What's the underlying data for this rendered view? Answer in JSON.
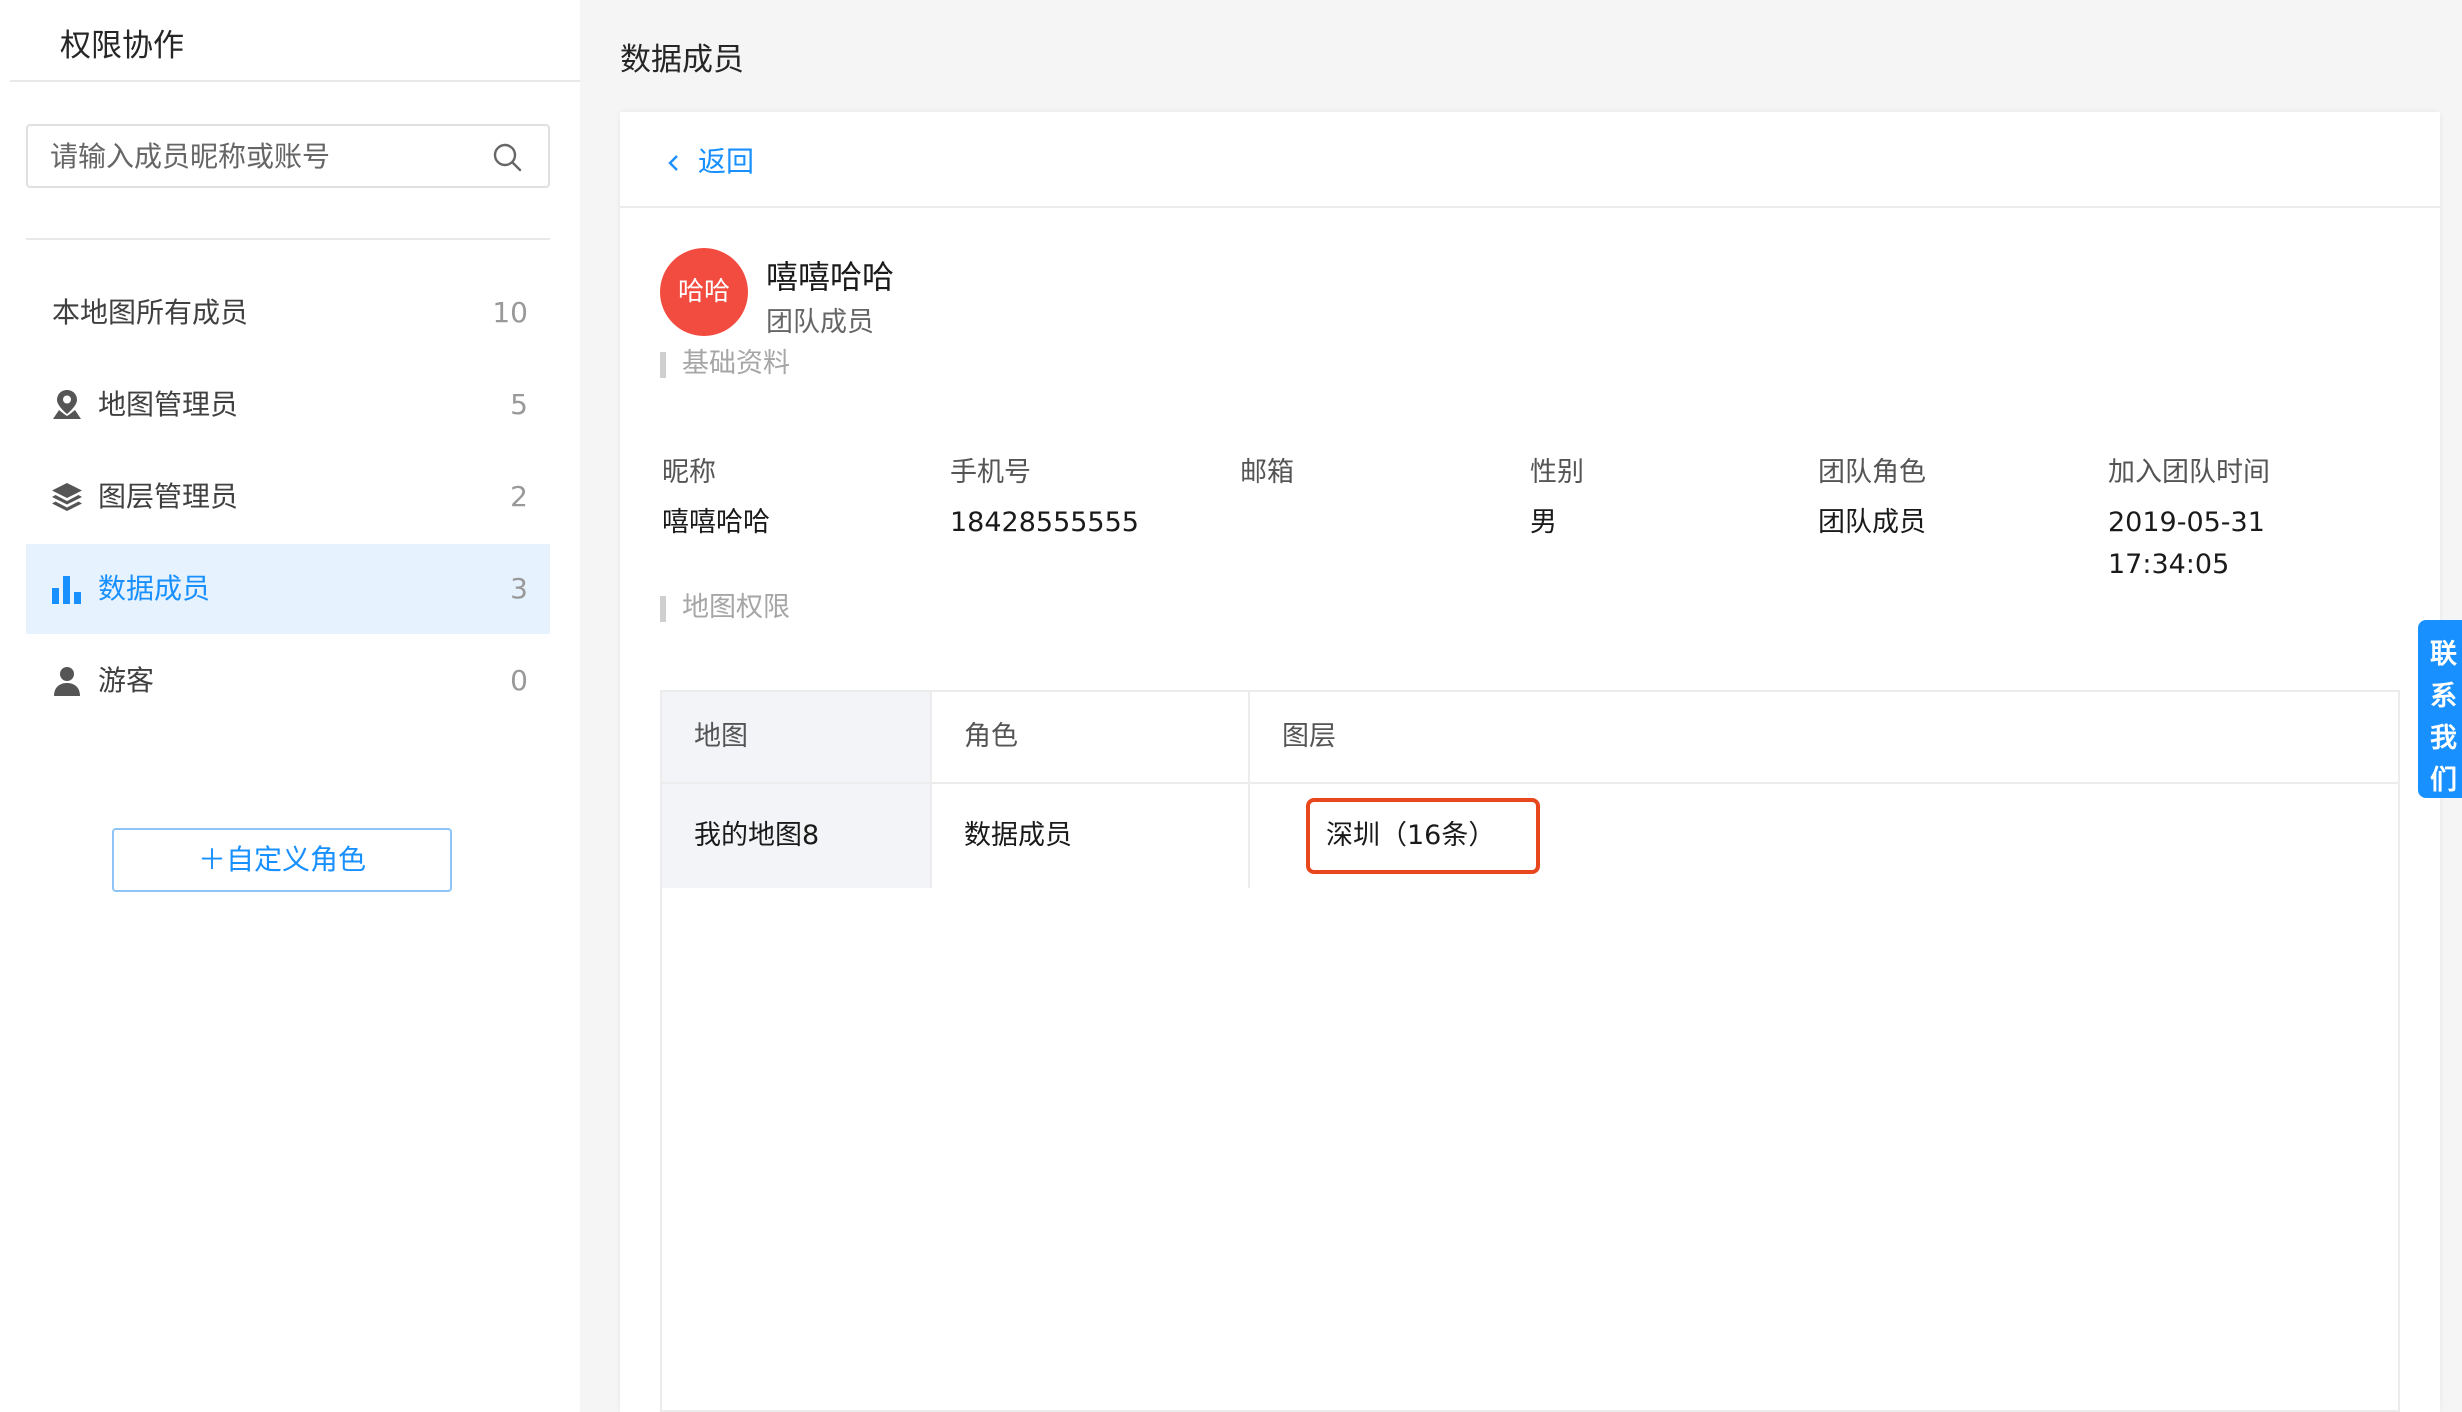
{
  "sidebar": {
    "title": "权限协作",
    "search": {
      "placeholder": "请输入成员昵称或账号",
      "value": ""
    },
    "items": [
      {
        "label": "本地图所有成员",
        "count": "10",
        "icon": "none"
      },
      {
        "label": "地图管理员",
        "count": "5",
        "icon": "map-admin-icon"
      },
      {
        "label": "图层管理员",
        "count": "2",
        "icon": "layers-icon"
      },
      {
        "label": "数据成员",
        "count": "3",
        "icon": "bar-chart-icon",
        "active": true
      },
      {
        "label": "游客",
        "count": "0",
        "icon": "user-icon"
      }
    ],
    "custom_role_button": "＋自定义角色"
  },
  "main": {
    "page_title": "数据成员",
    "back_label": "返回",
    "member": {
      "avatar_text": "哈哈",
      "name": "嘻嘻哈哈",
      "role": "团队成员"
    },
    "basic_info": {
      "section_title": "基础资料",
      "fields": [
        {
          "label": "昵称",
          "value": "嘻嘻哈哈"
        },
        {
          "label": "手机号",
          "value": "18428555555"
        },
        {
          "label": "邮箱",
          "value": ""
        },
        {
          "label": "性别",
          "value": "男"
        },
        {
          "label": "团队角色",
          "value": "团队成员"
        },
        {
          "label": "加入团队时间",
          "value_date": "2019-05-31",
          "value_time": "17:34:05"
        }
      ]
    },
    "map_permissions": {
      "section_title": "地图权限",
      "columns": [
        "地图",
        "角色",
        "图层"
      ],
      "rows": [
        {
          "map": "我的地图8",
          "role": "数据成员",
          "layer": "深圳（16条）"
        }
      ]
    }
  },
  "contact_float": [
    "联",
    "系",
    "我",
    "们"
  ],
  "colors": {
    "accent": "#1890ff",
    "avatar": "#f24b3f",
    "highlight_border": "#e8471d",
    "active_bg": "#e6f2fd"
  }
}
